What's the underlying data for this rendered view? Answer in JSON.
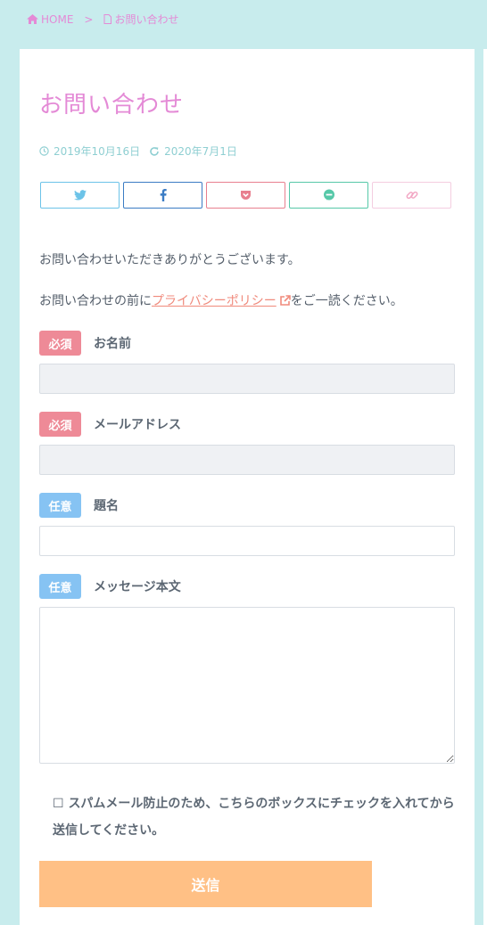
{
  "breadcrumb": {
    "home": "HOME",
    "separator": ">",
    "current": "お問い合わせ"
  },
  "page": {
    "title": "お問い合わせ",
    "published": "2019年10月16日",
    "updated": "2020年7月1日"
  },
  "share": {
    "buttons": [
      {
        "icon": "twitter-icon",
        "color": "#6cc3e8"
      },
      {
        "icon": "facebook-icon",
        "color": "#3b7cc4"
      },
      {
        "icon": "pocket-icon",
        "color": "#e87f8f"
      },
      {
        "icon": "line-icon",
        "color": "#56c8a8"
      },
      {
        "icon": "link-icon",
        "color": "#f2a7c4"
      }
    ]
  },
  "content": {
    "thanks": "お問い合わせいただきありがとうございます。",
    "privacy_prefix": "お問い合わせの前に",
    "privacy_link": "プライバシーポリシー",
    "privacy_suffix": "をご一読ください。"
  },
  "form": {
    "required": "必須",
    "optional": "任意",
    "name_label": "お名前",
    "email_label": "メールアドレス",
    "subject_label": "題名",
    "message_label": "メッセージ本文",
    "spam_check": "スパムメール防止のため、こちらのボックスにチェックを入れてから送信してください。",
    "submit": "送信"
  },
  "colors": {
    "background": "#c8eced",
    "accent_pink": "#e48ad6",
    "required_badge": "#ee8a97",
    "optional_badge": "#86c3f3",
    "submit": "#ffc085"
  }
}
